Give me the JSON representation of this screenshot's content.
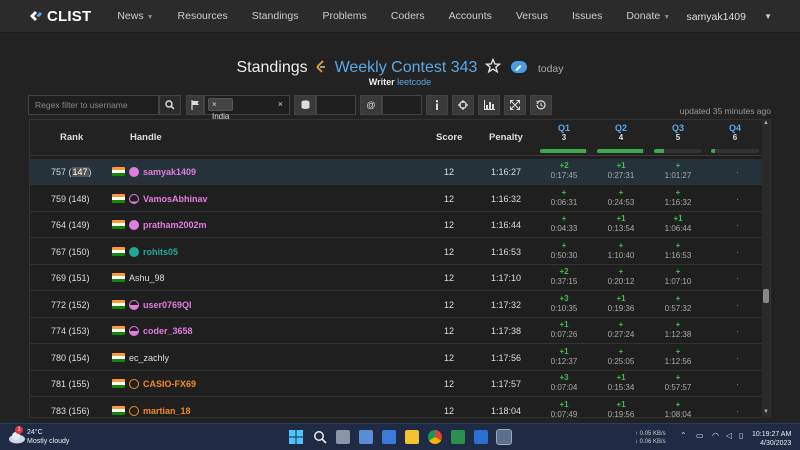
{
  "app": {
    "logo": "CLIST"
  },
  "nav": {
    "items": [
      "News",
      "Resources",
      "Standings",
      "Problems",
      "Coders",
      "Accounts",
      "Versus",
      "Issues",
      "Donate"
    ],
    "user": "samyak1409"
  },
  "header": {
    "title": "Standings",
    "contest": "Weekly Contest 343",
    "when": "today",
    "writer_label": "Writer",
    "writer": "leetcode"
  },
  "filters": {
    "regex_placeholder": "Regex filter to username",
    "country_tag": "India",
    "tag_x": "×",
    "at": "@"
  },
  "updated": "updated 35 minutes ago",
  "table": {
    "col_rank": "Rank",
    "col_handle": "Handle",
    "col_score": "Score",
    "col_penalty": "Penalty",
    "problems": [
      {
        "name": "Q1",
        "count": "3",
        "solved_fraction": 0.95
      },
      {
        "name": "Q2",
        "count": "4",
        "solved_fraction": 0.95
      },
      {
        "name": "Q3",
        "count": "5",
        "solved_fraction": 0.2
      },
      {
        "name": "Q4",
        "count": "6",
        "solved_fraction": 0.08
      }
    ],
    "rows": [
      {
        "rank": "757 (",
        "rank_hl": "147",
        "rank_end": ")",
        "handle": "samyak1409",
        "color": "#e07de0",
        "ring": "full",
        "score": "12",
        "penalty": "1:16:27",
        "q1": [
          "+2",
          "0:17:45"
        ],
        "q2": [
          "+1",
          "0:27:31"
        ],
        "q3": [
          "+",
          "1:01:27"
        ],
        "q4": "·",
        "me": true
      },
      {
        "rank": "759 (148)",
        "handle": "VamosAbhinav",
        "color": "#e07de0",
        "ring": "low",
        "score": "12",
        "penalty": "1:16:32",
        "q1": [
          "+",
          "0:06:31"
        ],
        "q2": [
          "+",
          "0:24:53"
        ],
        "q3": [
          "+",
          "1:16:32"
        ],
        "q4": "·"
      },
      {
        "rank": "764 (149)",
        "handle": "pratham2002m",
        "color": "#e07de0",
        "ring": "full",
        "score": "12",
        "penalty": "1:16:44",
        "q1": [
          "+",
          "0:04:33"
        ],
        "q2": [
          "+1",
          "0:13:54"
        ],
        "q3": [
          "+1",
          "1:06:44"
        ],
        "q4": "·"
      },
      {
        "rank": "767 (150)",
        "handle": "rohits05",
        "color": "#22a89a",
        "ring": "teal",
        "score": "12",
        "penalty": "1:16:53",
        "q1": [
          "+",
          "0:50:30"
        ],
        "q2": [
          "+",
          "1:10:40"
        ],
        "q3": [
          "+",
          "1:16:53"
        ],
        "q4": "·"
      },
      {
        "rank": "769 (151)",
        "handle": "Ashu_98",
        "color": "#dddddd",
        "ring": "none",
        "score": "12",
        "penalty": "1:17:10",
        "q1": [
          "+2",
          "0:37:15"
        ],
        "q2": [
          "+",
          "0:20:12"
        ],
        "q3": [
          "+",
          "1:07:10"
        ],
        "q4": "·"
      },
      {
        "rank": "772 (152)",
        "handle": "user0769QI",
        "color": "#e07de0",
        "ring": "half",
        "score": "12",
        "penalty": "1:17:32",
        "q1": [
          "+3",
          "0:10:35"
        ],
        "q2": [
          "+1",
          "0:19:36"
        ],
        "q3": [
          "+",
          "0:57:32"
        ],
        "q4": "·"
      },
      {
        "rank": "774 (153)",
        "handle": "coder_3658",
        "color": "#e07de0",
        "ring": "half",
        "score": "12",
        "penalty": "1:17:38",
        "q1": [
          "+1",
          "0:07:26"
        ],
        "q2": [
          "+",
          "0:27:24"
        ],
        "q3": [
          "+",
          "1:12:38"
        ],
        "q4": "·"
      },
      {
        "rank": "780 (154)",
        "handle": "ec_zachly",
        "color": "#dddddd",
        "ring": "none",
        "score": "12",
        "penalty": "1:17:56",
        "q1": [
          "+1",
          "0:12:37"
        ],
        "q2": [
          "+",
          "0:25:05"
        ],
        "q3": [
          "+",
          "1:12:56"
        ],
        "q4": "·"
      },
      {
        "rank": "781 (155)",
        "handle": "CASIO-FX69",
        "color": "#f08a24",
        "ring": "orange",
        "score": "12",
        "penalty": "1:17:57",
        "q1": [
          "+3",
          "0:07:04"
        ],
        "q2": [
          "+1",
          "0:15:34"
        ],
        "q3": [
          "+",
          "0:57:57"
        ],
        "q4": "·"
      },
      {
        "rank": "783 (156)",
        "handle": "martian_18",
        "color": "#f08a24",
        "ring": "orange",
        "score": "12",
        "penalty": "1:18:04",
        "q1": [
          "+1",
          "0:07:49"
        ],
        "q2": [
          "+1",
          "0:19:56"
        ],
        "q3": [
          "+",
          "1:08:04"
        ],
        "q4": "·"
      }
    ]
  },
  "taskbar": {
    "temp": "24°C",
    "weather": "Mostly cloudy",
    "badge": "1",
    "net_up": "↑ 0.05 KB/s",
    "net_down": "↓ 0.06 KB/s",
    "time": "10:19:27 AM",
    "date": "4/30/2023"
  },
  "colors": {
    "accent": "#5ca8e6",
    "success": "#3ec04a",
    "nav_bg": "#2b2b2b",
    "page_bg": "#222222"
  }
}
